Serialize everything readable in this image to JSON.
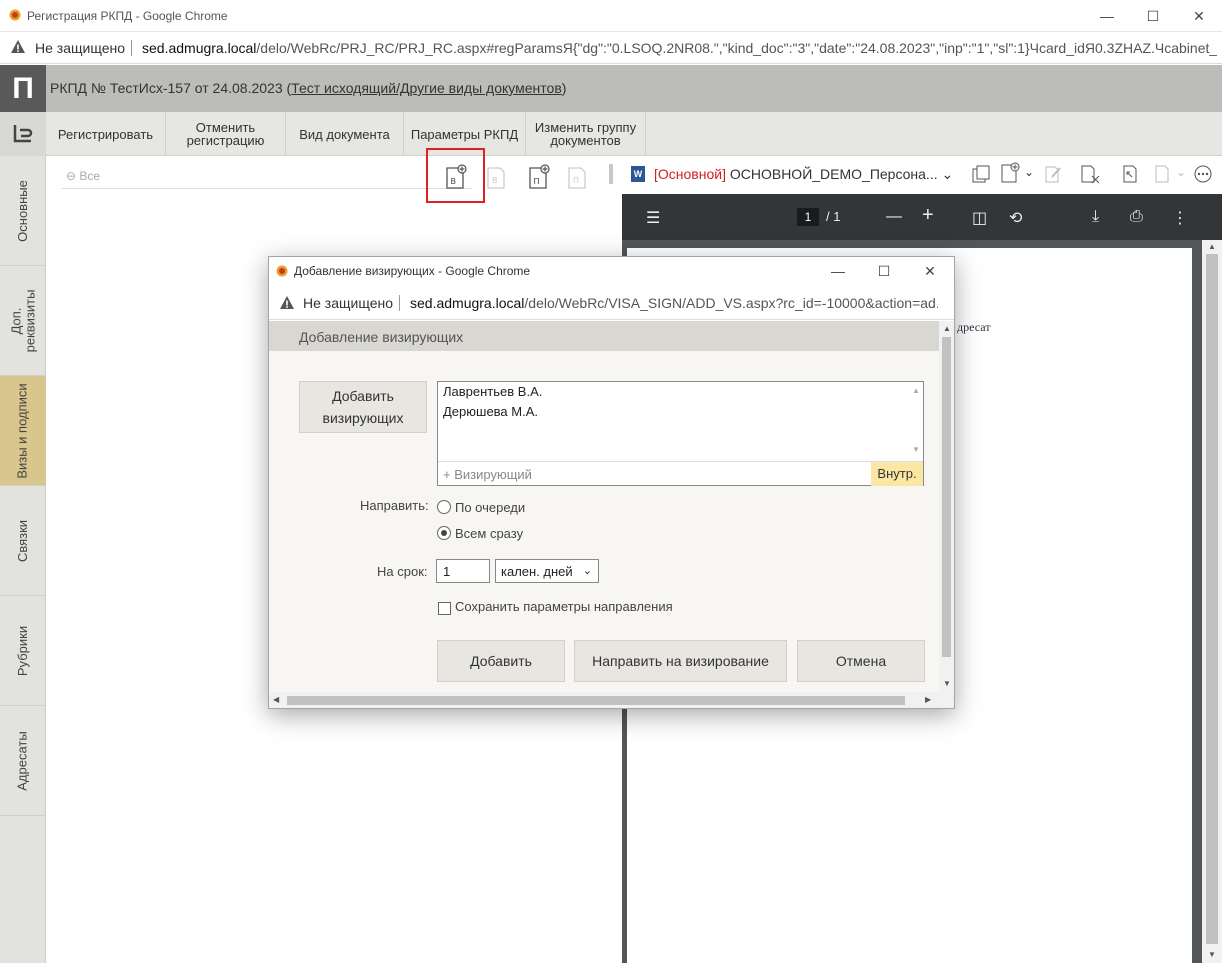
{
  "browser": {
    "window_title": "Регистрация РКПД - Google Chrome",
    "not_secure": "Не защищено",
    "url_host": "sed.admugra.local",
    "url_rest": "/delo/WebRc/PRJ_RC/PRJ_RC.aspx#regParamsЯ{\"dg\":\"0.LSOQ.2NR08.\",\"kind_doc\":\"3\",\"date\":\"24.08.2023\",\"inp\":\"1\",\"sl\":1}Чcard_idЯ0.3ZHAZ.Чcabinet_idЯ..."
  },
  "app": {
    "logo": "П",
    "title_prefix": "РКПД №  ТестИсх-157 от 24.08.2023 (",
    "title_link": "Тест исходящий/Другие виды документов",
    "title_suffix": ")"
  },
  "toolbar": {
    "register": "Регистрировать",
    "cancel_registration": "Отменить регистрацию",
    "doc_type": "Вид документа",
    "params": "Параметры РКПД",
    "change_group": "Изменить группу документов"
  },
  "vtabs": [
    "Основные",
    "Доп. реквизиты",
    "Визы и подписи",
    "Связки",
    "Рубрики",
    "Адресаты"
  ],
  "left_pane": {
    "filter": "Все"
  },
  "right_pane": {
    "doc_tag": "[Основной]",
    "doc_name": "ОСНОВНОЙ_DEMO_Персона...",
    "pdf_page": "1",
    "pdf_total": "/  1",
    "pdf_text": "дресат"
  },
  "modal": {
    "window_title": "Добавление визирующих - Google Chrome",
    "not_secure": "Не защищено",
    "url_host": "sed.admugra.local",
    "url_rest": "/delo/WebRc/VISA_SIGN/ADD_VS.aspx?rc_id=-10000&action=ad...",
    "header": "Добавление визирующих",
    "add_visors_button": "Добавить визирующих",
    "visors": [
      "Лаврентьев В.А.",
      "Дерюшева М.А."
    ],
    "visor_placeholder": "Визирующий",
    "internal_badge": "Внутр.",
    "send_label": "Направить:",
    "option_sequential": "По очереди",
    "option_all": "Всем сразу",
    "selected_option": "Всем сразу",
    "term_label": "На срок:",
    "term_value": "1",
    "term_unit": "кален. дней",
    "save_params_label": "Сохранить параметры направления",
    "save_params_checked": false,
    "add_button": "Добавить",
    "send_button": "Направить на визирование",
    "cancel_button": "Отмена"
  }
}
